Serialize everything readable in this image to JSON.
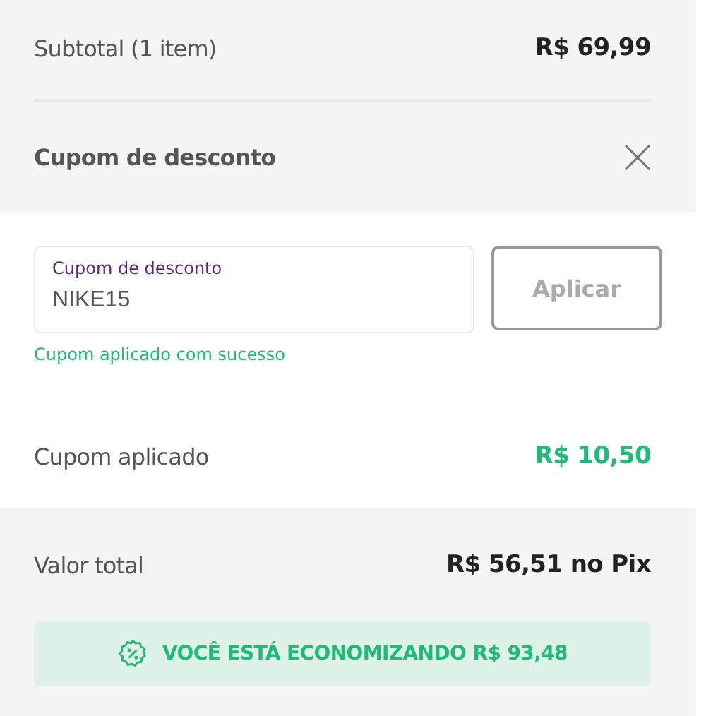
{
  "subtotal": {
    "label": "Subtotal (1 item)",
    "value": "R$ 69,99"
  },
  "coupon_section": {
    "title": "Cupom de desconto",
    "expanded": true
  },
  "coupon_field": {
    "label": "Cupom de desconto",
    "value": "NIKE15"
  },
  "apply_button": {
    "label": "Aplicar",
    "disabled": true
  },
  "success_message": "Cupom aplicado com sucesso",
  "applied_coupon": {
    "label": "Cupom aplicado",
    "value": "R$ 10,50"
  },
  "total": {
    "label": "Valor total",
    "value": "R$ 56,51 no Pix"
  },
  "savings_banner": "VOCÊ ESTÁ ECONOMIZANDO R$ 93,48"
}
